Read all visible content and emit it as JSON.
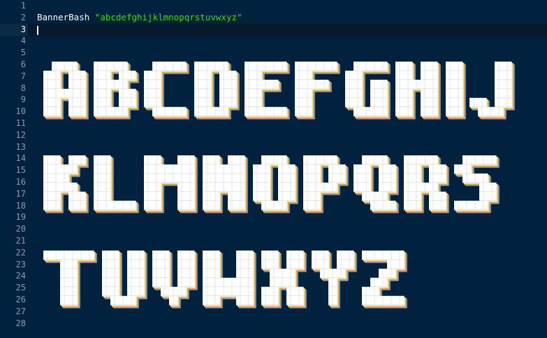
{
  "editor": {
    "line_numbers": [
      "1",
      "2",
      "3",
      "4",
      "5",
      "6",
      "7",
      "8",
      "9",
      "10",
      "11",
      "12",
      "13",
      "14",
      "15",
      "16",
      "17",
      "18",
      "19",
      "20",
      "21",
      "22",
      "23",
      "24",
      "25",
      "26",
      "27",
      "28"
    ],
    "current_line": "3",
    "code": {
      "line2_keyword": "BannerBash",
      "line2_string": "\"abcdefghijklmnopqrstuvwxyz\""
    }
  },
  "banner": {
    "rows": [
      [
        "A",
        "B",
        "C",
        "D",
        "E",
        "F",
        "G",
        "H",
        "I",
        "J"
      ],
      [
        "K",
        "L",
        "M",
        "N",
        "O",
        "P",
        "Q",
        "R",
        "S"
      ],
      [
        "T",
        "U",
        "V",
        "W",
        "X",
        "Y",
        "Z"
      ]
    ]
  },
  "colors": {
    "background": "#00223f",
    "line_number": "#8a9bb0",
    "string": "#3ad900",
    "glyph_fill": "#ffffff",
    "glyph_grid": "#c8c8c8",
    "shadow_yellow": "#e8e36a",
    "shadow_red": "#e0506a",
    "shadow_cyan": "#7fd8ff"
  }
}
